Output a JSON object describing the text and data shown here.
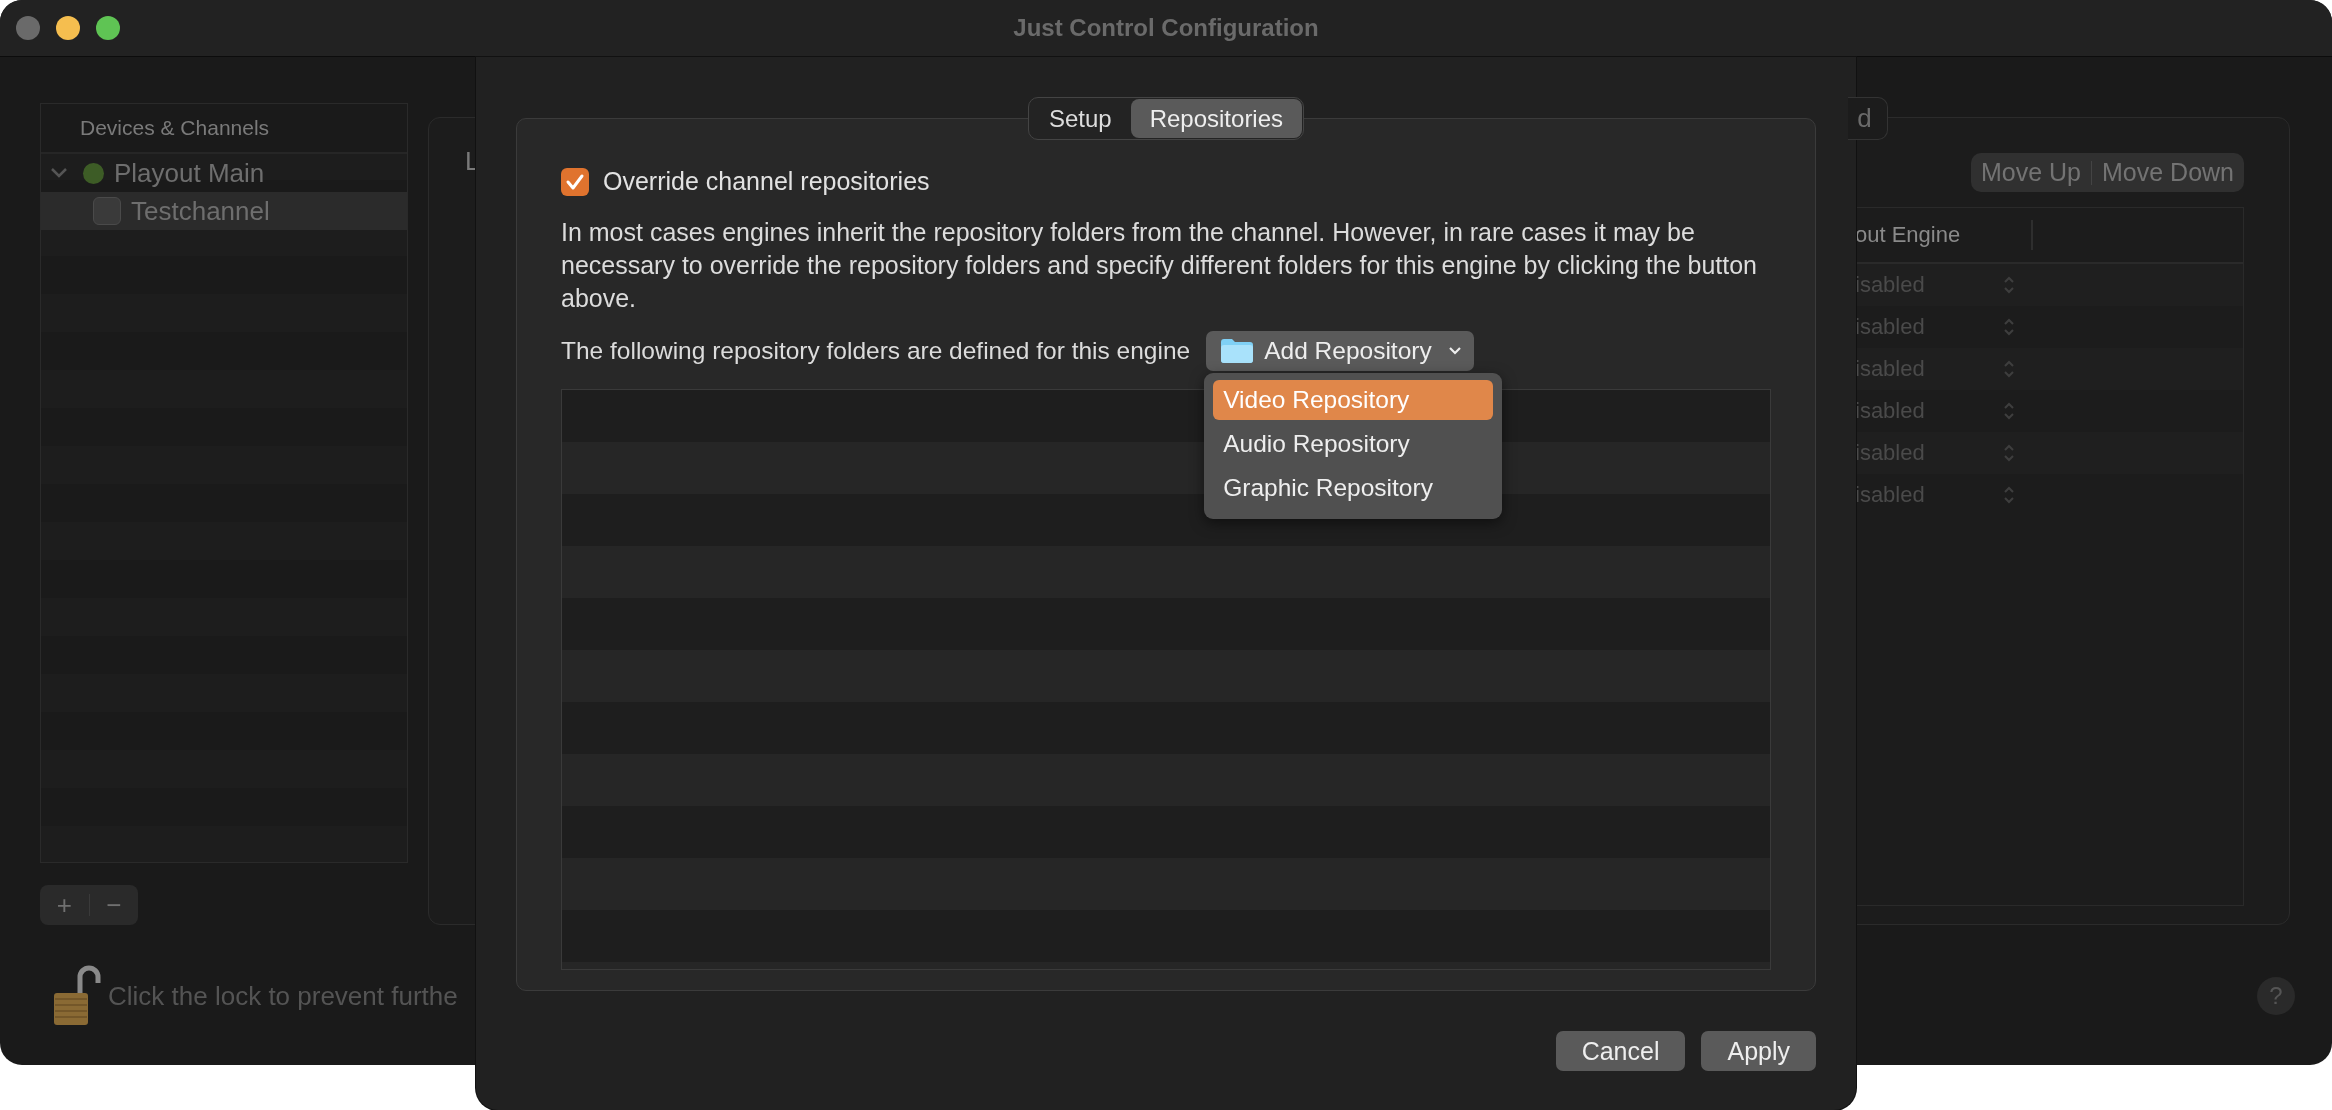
{
  "window": {
    "title": "Just Control Configuration"
  },
  "sidebar": {
    "header": "Devices & Channels",
    "items": [
      {
        "label": "Playout Main",
        "expanded": true,
        "selected": false,
        "children": [
          {
            "label": "Testchannel",
            "selected": true,
            "checked": false
          }
        ]
      }
    ]
  },
  "sidebar_buttons": [
    "+",
    "−"
  ],
  "lock_message": "Click the lock to prevent furthe",
  "main_panel": {
    "label": "L",
    "tab_fragment": "d",
    "buttons": [
      "Move Up",
      "Move Down"
    ],
    "table": {
      "columns": [
        "out Engine"
      ],
      "rows": [
        {
          "column_1": "isabled"
        },
        {
          "column_1": "isabled"
        },
        {
          "column_1": "isabled"
        },
        {
          "column_1": "isabled"
        },
        {
          "column_1": "isabled"
        },
        {
          "column_1": "isabled"
        }
      ]
    }
  },
  "help_button": "?",
  "sheet": {
    "tabs": [
      {
        "label": "Setup",
        "selected": false
      },
      {
        "label": "Repositories",
        "selected": true
      }
    ],
    "override": {
      "label": "Override channel repositories",
      "checked": true
    },
    "description": "In most cases engines inherit the repository folders from the channel. However, in rare cases it may be necessary to override the repository folders and specify different folders for this engine by clicking the button above.",
    "list_label": "The following repository folders are defined for this engine",
    "add_button": "Add Repository",
    "menu": [
      {
        "label": "Video Repository",
        "selected": true
      },
      {
        "label": "Audio Repository",
        "selected": false
      },
      {
        "label": "Graphic Repository",
        "selected": false
      }
    ],
    "buttons": [
      "Cancel",
      "Apply"
    ]
  }
}
